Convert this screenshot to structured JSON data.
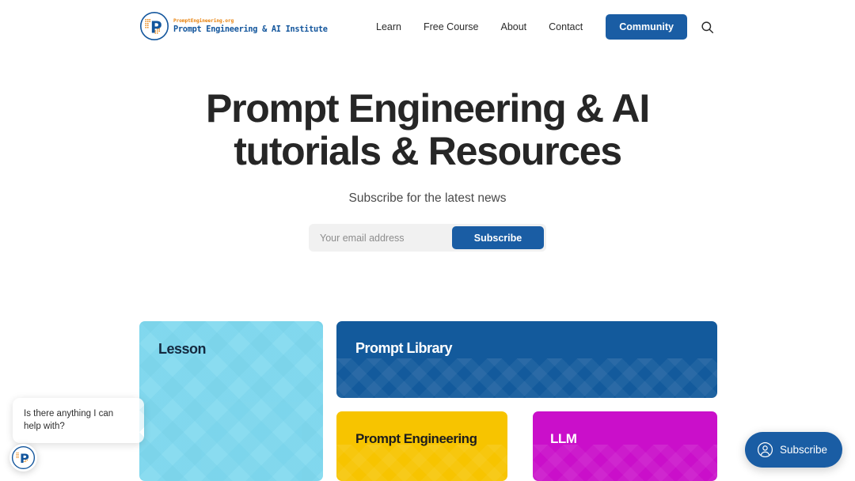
{
  "header": {
    "logo": {
      "top_text": "PromptEngineering.org",
      "bottom_text": "Prompt Engineering & AI Institute",
      "mark_letter": "P"
    },
    "nav_items": [
      {
        "label": "Learn"
      },
      {
        "label": "Free Course"
      },
      {
        "label": "About"
      },
      {
        "label": "Contact"
      }
    ],
    "community_label": "Community",
    "search_icon": "search-icon"
  },
  "hero": {
    "title_line1": "Prompt Engineering & AI",
    "title_line2": "tutorials & Resources",
    "subtitle": "Subscribe for the latest news",
    "form": {
      "placeholder": "Your email address",
      "value": "",
      "submit_label": "Subscribe"
    }
  },
  "cards": [
    {
      "title": "Lesson",
      "color": "#8adcf0",
      "text_color": "#14293f"
    },
    {
      "title": "Prompt Library",
      "color": "#135a9c",
      "text_color": "#ffffff"
    },
    {
      "title": "Prompt Engineering",
      "color": "#f7c400",
      "text_color": "#1d1d1d"
    },
    {
      "title": "LLM",
      "color": "#ca0fca",
      "text_color": "#ffffff"
    }
  ],
  "chat": {
    "message": "Is there anything I can help with?",
    "avatar_letter": "P"
  },
  "portal": {
    "subscribe_label": "Subscribe",
    "icon": "user-circle-icon"
  },
  "colors": {
    "brand_blue": "#1a5da4",
    "logo_orange": "#e8820c",
    "logo_blue": "#12559c",
    "heading": "#262626"
  }
}
